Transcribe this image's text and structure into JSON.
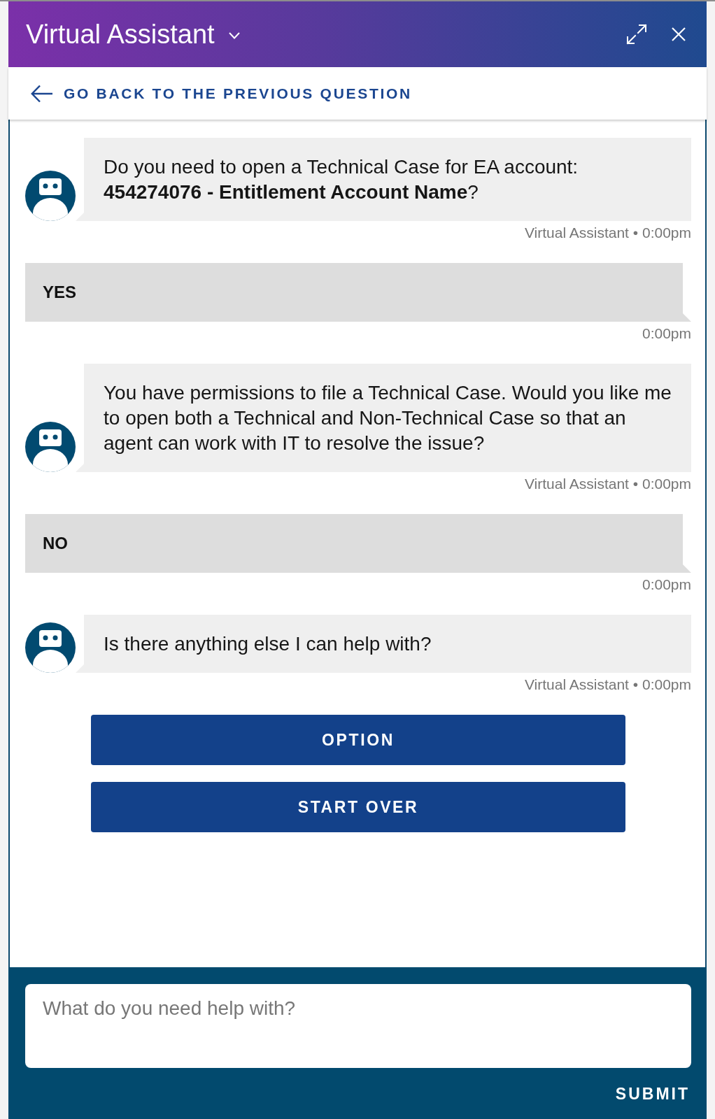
{
  "header": {
    "title": "Virtual Assistant"
  },
  "back_link": {
    "label": "GO BACK TO THE PREVIOUS QUESTION"
  },
  "messages": [
    {
      "kind": "bot",
      "text": "Do you need to open a Technical Case for EA account: **454274076 - Entitlement Account Name**?",
      "meta": "Virtual Assistant • 0:00pm"
    },
    {
      "kind": "user",
      "text": "YES",
      "meta": "0:00pm"
    },
    {
      "kind": "bot",
      "text": "You have permissions to file a Technical Case. Would you like me to open both a Technical and Non-Technical Case so that an agent can work with IT to resolve the issue?",
      "meta": "Virtual Assistant • 0:00pm"
    },
    {
      "kind": "user",
      "text": "NO",
      "meta": "0:00pm"
    },
    {
      "kind": "bot",
      "text": "Is there anything else I can help with?",
      "meta": "Virtual Assistant • 0:00pm"
    }
  ],
  "options": [
    {
      "label": "OPTION"
    },
    {
      "label": "START OVER"
    }
  ],
  "composer": {
    "placeholder": "What do you need help with?",
    "submit": "SUBMIT"
  }
}
